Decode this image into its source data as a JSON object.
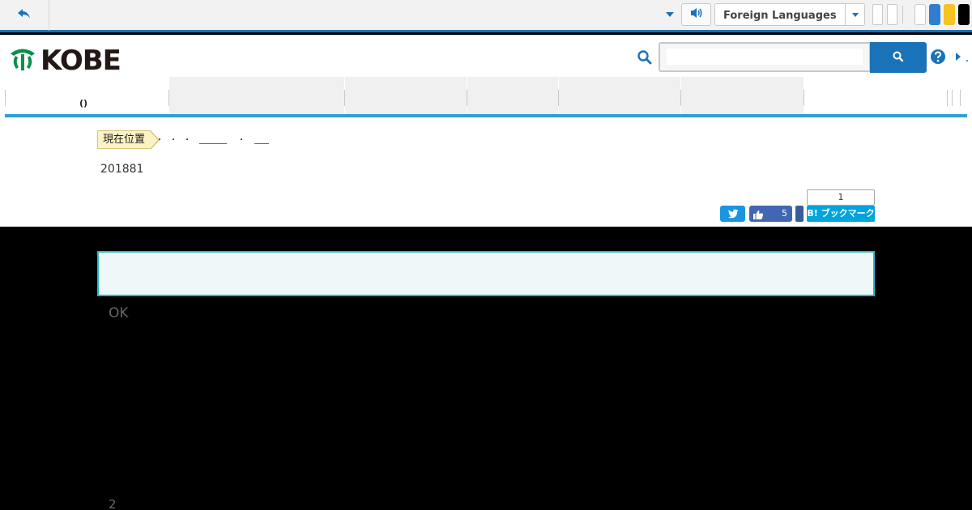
{
  "topbar": {
    "back_icon": "reply-arrow-icon",
    "audio_icon": "speaker-icon",
    "language_select": "Foreign Languages",
    "colors": {
      "blue": "#2f7fd0",
      "yellow": "#f6c323",
      "black": "#000000"
    }
  },
  "header": {
    "logo_text": "KOBE",
    "logo_color": "#0b8f4c",
    "search_placeholder": "",
    "help_icon": "question-circle-icon"
  },
  "nav": {
    "items": [
      "()",
      "",
      "",
      "",
      "",
      "",
      ""
    ]
  },
  "breadcrumb": {
    "label": "現在位置"
  },
  "content": {
    "update_date": "201881"
  },
  "social": {
    "like_count": "5",
    "hatena_count": "1",
    "hatena_label": "B! ブックマーク"
  },
  "body": {
    "ok_text": "OK",
    "page_number": "2"
  }
}
